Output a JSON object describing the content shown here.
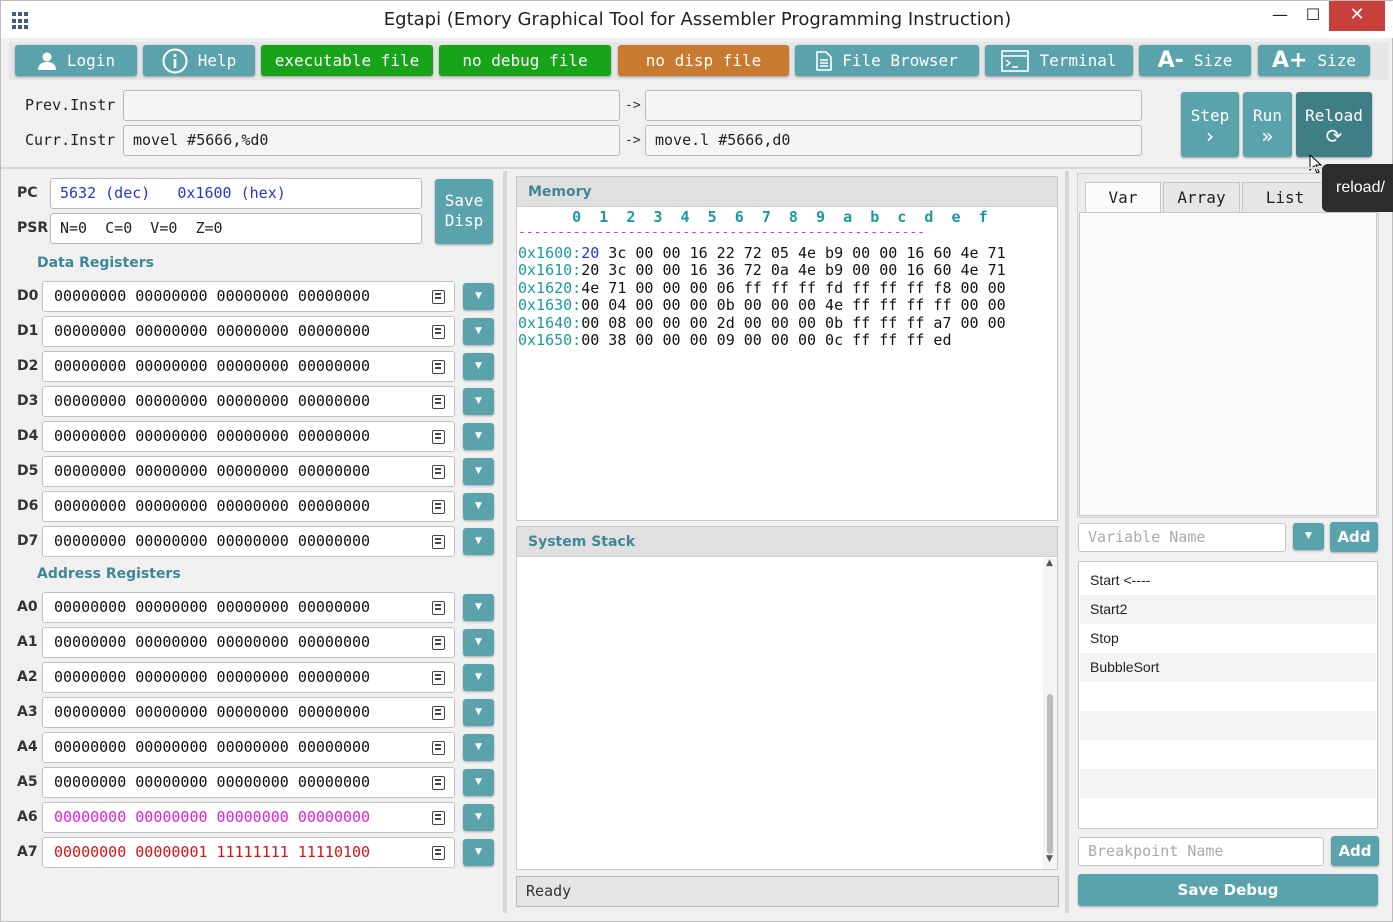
{
  "window": {
    "title": "Egtapi (Emory Graphical Tool for Assembler Programming Instruction)",
    "minimize": "—",
    "maximize": "☐",
    "close": "✕"
  },
  "toolbar": {
    "login": "Login",
    "help": "Help",
    "executable": "executable file",
    "debug": "no debug file",
    "disp": "no disp file",
    "file_browser": "File Browser",
    "terminal": "Terminal",
    "size_minus": "Size",
    "size_plus": "Size",
    "a_minus": "A-",
    "a_plus": "A+",
    "colors": {
      "teal": "#5aa3ad",
      "green": "#18a418",
      "orange": "#c87a30"
    }
  },
  "instr": {
    "prev_label": "Prev.Instr",
    "curr_label": "Curr.Instr",
    "arrow": "->",
    "prev_src": "",
    "prev_dst": "",
    "curr_src": "movel #5666,%d0",
    "curr_dst": "move.l #5666,d0"
  },
  "controls": {
    "step": "Step",
    "run": "Run",
    "reload": "Reload",
    "tooltip": "reload/"
  },
  "pc": {
    "label": "PC",
    "dec": "5632 (dec)",
    "hex": "0x1600 (hex)"
  },
  "psr": {
    "label": "PSR",
    "value": "N=0  C=0  V=0  Z=0"
  },
  "save_disp": "Save Disp",
  "data_registers": {
    "title": "Data Registers",
    "items": [
      {
        "name": "D0",
        "value": "00000000 00000000 00000000 00000000"
      },
      {
        "name": "D1",
        "value": "00000000 00000000 00000000 00000000"
      },
      {
        "name": "D2",
        "value": "00000000 00000000 00000000 00000000"
      },
      {
        "name": "D3",
        "value": "00000000 00000000 00000000 00000000"
      },
      {
        "name": "D4",
        "value": "00000000 00000000 00000000 00000000"
      },
      {
        "name": "D5",
        "value": "00000000 00000000 00000000 00000000"
      },
      {
        "name": "D6",
        "value": "00000000 00000000 00000000 00000000"
      },
      {
        "name": "D7",
        "value": "00000000 00000000 00000000 00000000"
      }
    ]
  },
  "address_registers": {
    "title": "Address Registers",
    "items": [
      {
        "name": "A0",
        "value": "00000000 00000000 00000000 00000000",
        "color": "#111111"
      },
      {
        "name": "A1",
        "value": "00000000 00000000 00000000 00000000",
        "color": "#111111"
      },
      {
        "name": "A2",
        "value": "00000000 00000000 00000000 00000000",
        "color": "#111111"
      },
      {
        "name": "A3",
        "value": "00000000 00000000 00000000 00000000",
        "color": "#111111"
      },
      {
        "name": "A4",
        "value": "00000000 00000000 00000000 00000000",
        "color": "#111111"
      },
      {
        "name": "A5",
        "value": "00000000 00000000 00000000 00000000",
        "color": "#111111"
      },
      {
        "name": "A6",
        "value": "00000000 00000000 00000000 00000000",
        "color": "#e01ee0"
      },
      {
        "name": "A7",
        "value": "00000000 00000001 11111111 11110100",
        "color": "#e01010"
      }
    ]
  },
  "memory": {
    "title": "Memory",
    "header": "      0  1  2  3  4  5  6  7  8  9  a  b  c  d  e  f",
    "separator": "----------------------------------------------------",
    "rows": [
      {
        "addr": "0x1600:",
        "first": "20",
        "rest": " 3c 00 00 16 22 72 05 4e b9 00 00 16 60 4e 71"
      },
      {
        "addr": "0x1610:",
        "first": "20",
        "rest": " 3c 00 00 16 36 72 0a 4e b9 00 00 16 60 4e 71"
      },
      {
        "addr": "0x1620:",
        "first": "4e",
        "rest": " 71 00 00 00 06 ff ff ff fd ff ff ff f8 00 00"
      },
      {
        "addr": "0x1630:",
        "first": "00",
        "rest": " 04 00 00 00 0b 00 00 00 4e ff ff ff ff 00 00"
      },
      {
        "addr": "0x1640:",
        "first": "00",
        "rest": " 08 00 00 00 2d 00 00 00 0b ff ff ff a7 00 00"
      },
      {
        "addr": "0x1650:",
        "first": "00",
        "rest": " 38 00 00 00 09 00 00 00 0c ff ff ff ed"
      }
    ],
    "colors": {
      "addr": "#1a9aa0",
      "pc": "#1f3ac8",
      "sep": "#d030d0"
    }
  },
  "stack": {
    "title": "System Stack"
  },
  "status": "Ready",
  "right": {
    "tabs": [
      "Var",
      "Array",
      "List"
    ],
    "var_placeholder": "Variable Name",
    "add": "Add",
    "labels": [
      "Start <----",
      "Start2",
      "Stop",
      "BubbleSort",
      "",
      "",
      "",
      "",
      ""
    ],
    "bp_placeholder": "Breakpoint Name",
    "bp_add": "Add",
    "save_debug": "Save Debug"
  }
}
